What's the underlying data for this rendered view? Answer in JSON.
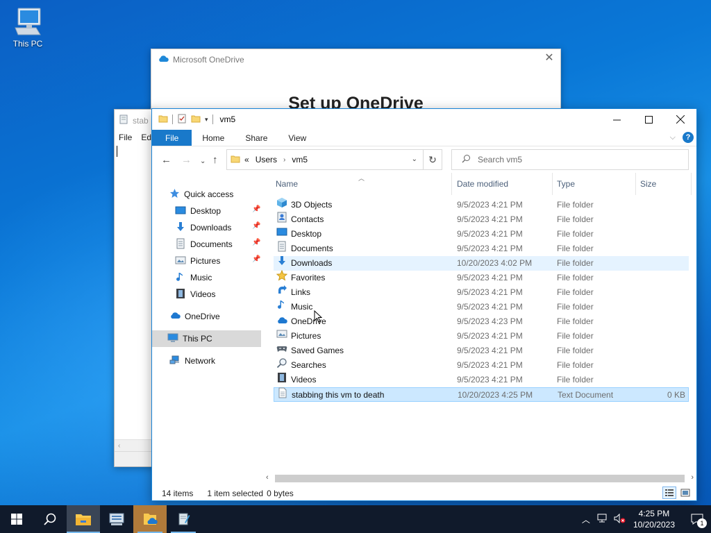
{
  "desktop": {
    "icon_label": "This PC"
  },
  "onedrive": {
    "title": "Microsoft OneDrive",
    "heading": "Set up OneDrive"
  },
  "notepad": {
    "title_fragment": "stab",
    "menu": [
      "File",
      "Edi"
    ]
  },
  "explorer": {
    "window_title": "vm5",
    "ribbon_tabs": [
      "File",
      "Home",
      "Share",
      "View"
    ],
    "address": {
      "prefix": "«",
      "crumbs": [
        "Users",
        "vm5"
      ]
    },
    "search_placeholder": "Search vm5",
    "nav": {
      "quick_access": "Quick access",
      "pinned": [
        "Desktop",
        "Downloads",
        "Documents",
        "Pictures"
      ],
      "unpinned": [
        "Music",
        "Videos"
      ],
      "onedrive": "OneDrive",
      "this_pc": "This PC",
      "network": "Network"
    },
    "columns": {
      "name": "Name",
      "date": "Date modified",
      "type": "Type",
      "size": "Size"
    },
    "files": [
      {
        "name": "3D Objects",
        "date": "9/5/2023 4:21 PM",
        "type": "File folder",
        "size": "",
        "icon": "3d-objects-icon"
      },
      {
        "name": "Contacts",
        "date": "9/5/2023 4:21 PM",
        "type": "File folder",
        "size": "",
        "icon": "contacts-icon"
      },
      {
        "name": "Desktop",
        "date": "9/5/2023 4:21 PM",
        "type": "File folder",
        "size": "",
        "icon": "desktop-folder-icon"
      },
      {
        "name": "Documents",
        "date": "9/5/2023 4:21 PM",
        "type": "File folder",
        "size": "",
        "icon": "documents-icon"
      },
      {
        "name": "Downloads",
        "date": "10/20/2023 4:02 PM",
        "type": "File folder",
        "size": "",
        "icon": "downloads-icon"
      },
      {
        "name": "Favorites",
        "date": "9/5/2023 4:21 PM",
        "type": "File folder",
        "size": "",
        "icon": "favorites-icon"
      },
      {
        "name": "Links",
        "date": "9/5/2023 4:21 PM",
        "type": "File folder",
        "size": "",
        "icon": "links-icon"
      },
      {
        "name": "Music",
        "date": "9/5/2023 4:21 PM",
        "type": "File folder",
        "size": "",
        "icon": "music-icon"
      },
      {
        "name": "OneDrive",
        "date": "9/5/2023 4:23 PM",
        "type": "File folder",
        "size": "",
        "icon": "onedrive-icon"
      },
      {
        "name": "Pictures",
        "date": "9/5/2023 4:21 PM",
        "type": "File folder",
        "size": "",
        "icon": "pictures-icon"
      },
      {
        "name": "Saved Games",
        "date": "9/5/2023 4:21 PM",
        "type": "File folder",
        "size": "",
        "icon": "saved-games-icon"
      },
      {
        "name": "Searches",
        "date": "9/5/2023 4:21 PM",
        "type": "File folder",
        "size": "",
        "icon": "searches-icon"
      },
      {
        "name": "Videos",
        "date": "9/5/2023 4:21 PM",
        "type": "File folder",
        "size": "",
        "icon": "videos-icon"
      },
      {
        "name": "stabbing this vm to death",
        "date": "10/20/2023 4:25 PM",
        "type": "Text Document",
        "size": "0 KB",
        "icon": "text-document-icon"
      }
    ],
    "status": {
      "count": "14 items",
      "selected": "1 item selected",
      "bytes": "0 bytes"
    }
  },
  "taskbar": {
    "time": "4:25 PM",
    "date": "10/20/2023",
    "notification_count": "1"
  },
  "colors": {
    "accent": "#1979ca",
    "selection": "#cce8ff",
    "hover": "#e5f3ff",
    "taskbar": "#101a2b"
  }
}
